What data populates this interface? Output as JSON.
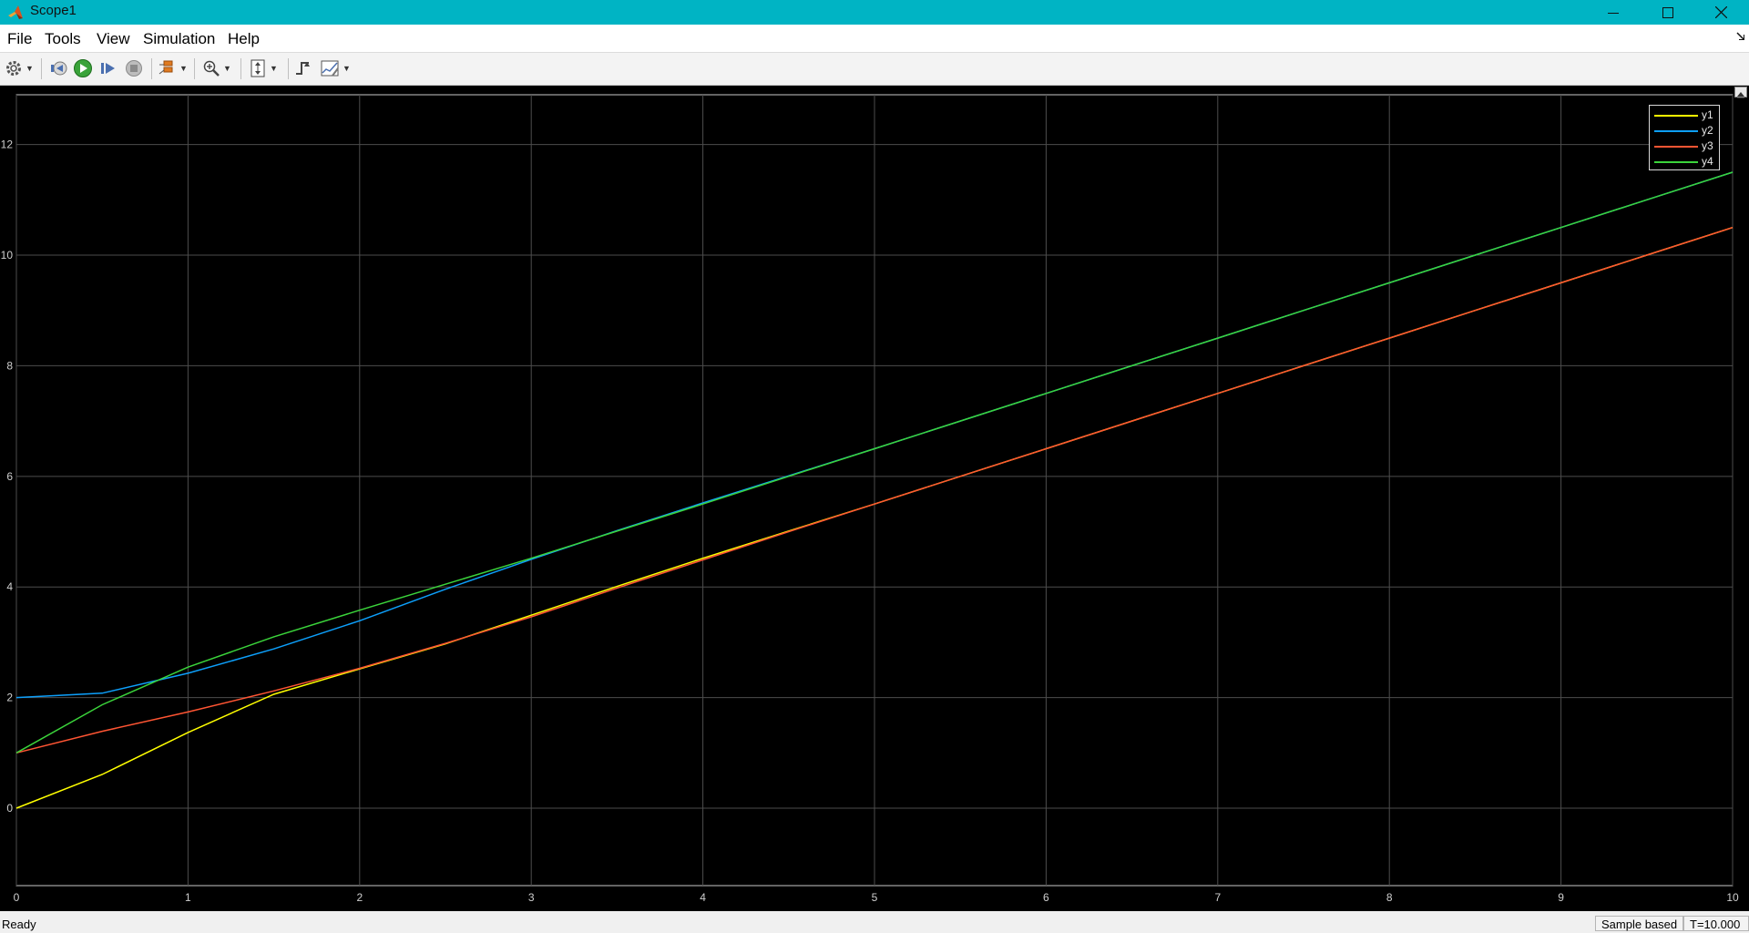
{
  "window": {
    "title": "Scope1",
    "icon": "matlab-logo-icon",
    "controls": [
      "minimize-icon",
      "maximize-icon",
      "close-icon"
    ]
  },
  "menu": {
    "items": [
      "File",
      "Tools",
      "View",
      "Simulation",
      "Help"
    ]
  },
  "toolbar": {
    "buttons": [
      "settings-icon",
      "step-back-icon",
      "run-icon",
      "step-forward-icon",
      "stop-icon",
      "signal-select-icon",
      "zoom-in-icon",
      "autoscale-icon",
      "triggers-icon",
      "measurements-icon"
    ]
  },
  "status": {
    "text": "Ready",
    "mode": "Sample based",
    "time": "T=10.000"
  },
  "chart_data": {
    "type": "line",
    "title": "",
    "xlabel": "",
    "ylabel": "",
    "xlim": [
      0,
      10
    ],
    "ylim": [
      -1.4,
      12.9
    ],
    "x_ticks": [
      0,
      1,
      2,
      3,
      4,
      5,
      6,
      7,
      8,
      9,
      10
    ],
    "y_ticks": [
      0,
      2,
      4,
      6,
      8,
      10,
      12
    ],
    "grid": true,
    "background": "#000000",
    "legend_position": "top-right",
    "x": [
      0,
      0.5,
      1,
      1.5,
      2,
      2.5,
      3,
      3.5,
      4,
      4.5,
      5,
      5.5,
      6,
      6.5,
      7,
      7.5,
      8,
      8.5,
      9,
      9.5,
      10
    ],
    "series": [
      {
        "name": "y1",
        "color": "#ffff00",
        "values": [
          0,
          0.61,
          1.37,
          2.06,
          2.52,
          2.97,
          3.49,
          4.01,
          4.52,
          5.01,
          5.5,
          6.0,
          6.5,
          7.0,
          7.5,
          8.0,
          8.5,
          9.0,
          9.5,
          10.0,
          10.5
        ]
      },
      {
        "name": "y2",
        "color": "#0d9ffa",
        "values": [
          2.0,
          2.08,
          2.44,
          2.88,
          3.39,
          3.96,
          4.5,
          5.02,
          5.52,
          6.01,
          6.5,
          7.0,
          7.5,
          8.0,
          8.5,
          9.0,
          9.5,
          10.0,
          10.5,
          11.0,
          11.5
        ]
      },
      {
        "name": "y3",
        "color": "#ff5533",
        "values": [
          1.0,
          1.39,
          1.74,
          2.12,
          2.53,
          2.98,
          3.46,
          3.98,
          4.49,
          5.0,
          5.5,
          6.0,
          6.5,
          7.0,
          7.5,
          8.0,
          8.5,
          9.0,
          9.5,
          10.0,
          10.5
        ]
      },
      {
        "name": "y4",
        "color": "#3bd43b",
        "values": [
          1.0,
          1.87,
          2.55,
          3.1,
          3.58,
          4.05,
          4.52,
          5.01,
          5.5,
          6.0,
          6.5,
          7.0,
          7.5,
          8.0,
          8.5,
          9.0,
          9.5,
          10.0,
          10.5,
          11.0,
          11.5
        ]
      }
    ]
  }
}
